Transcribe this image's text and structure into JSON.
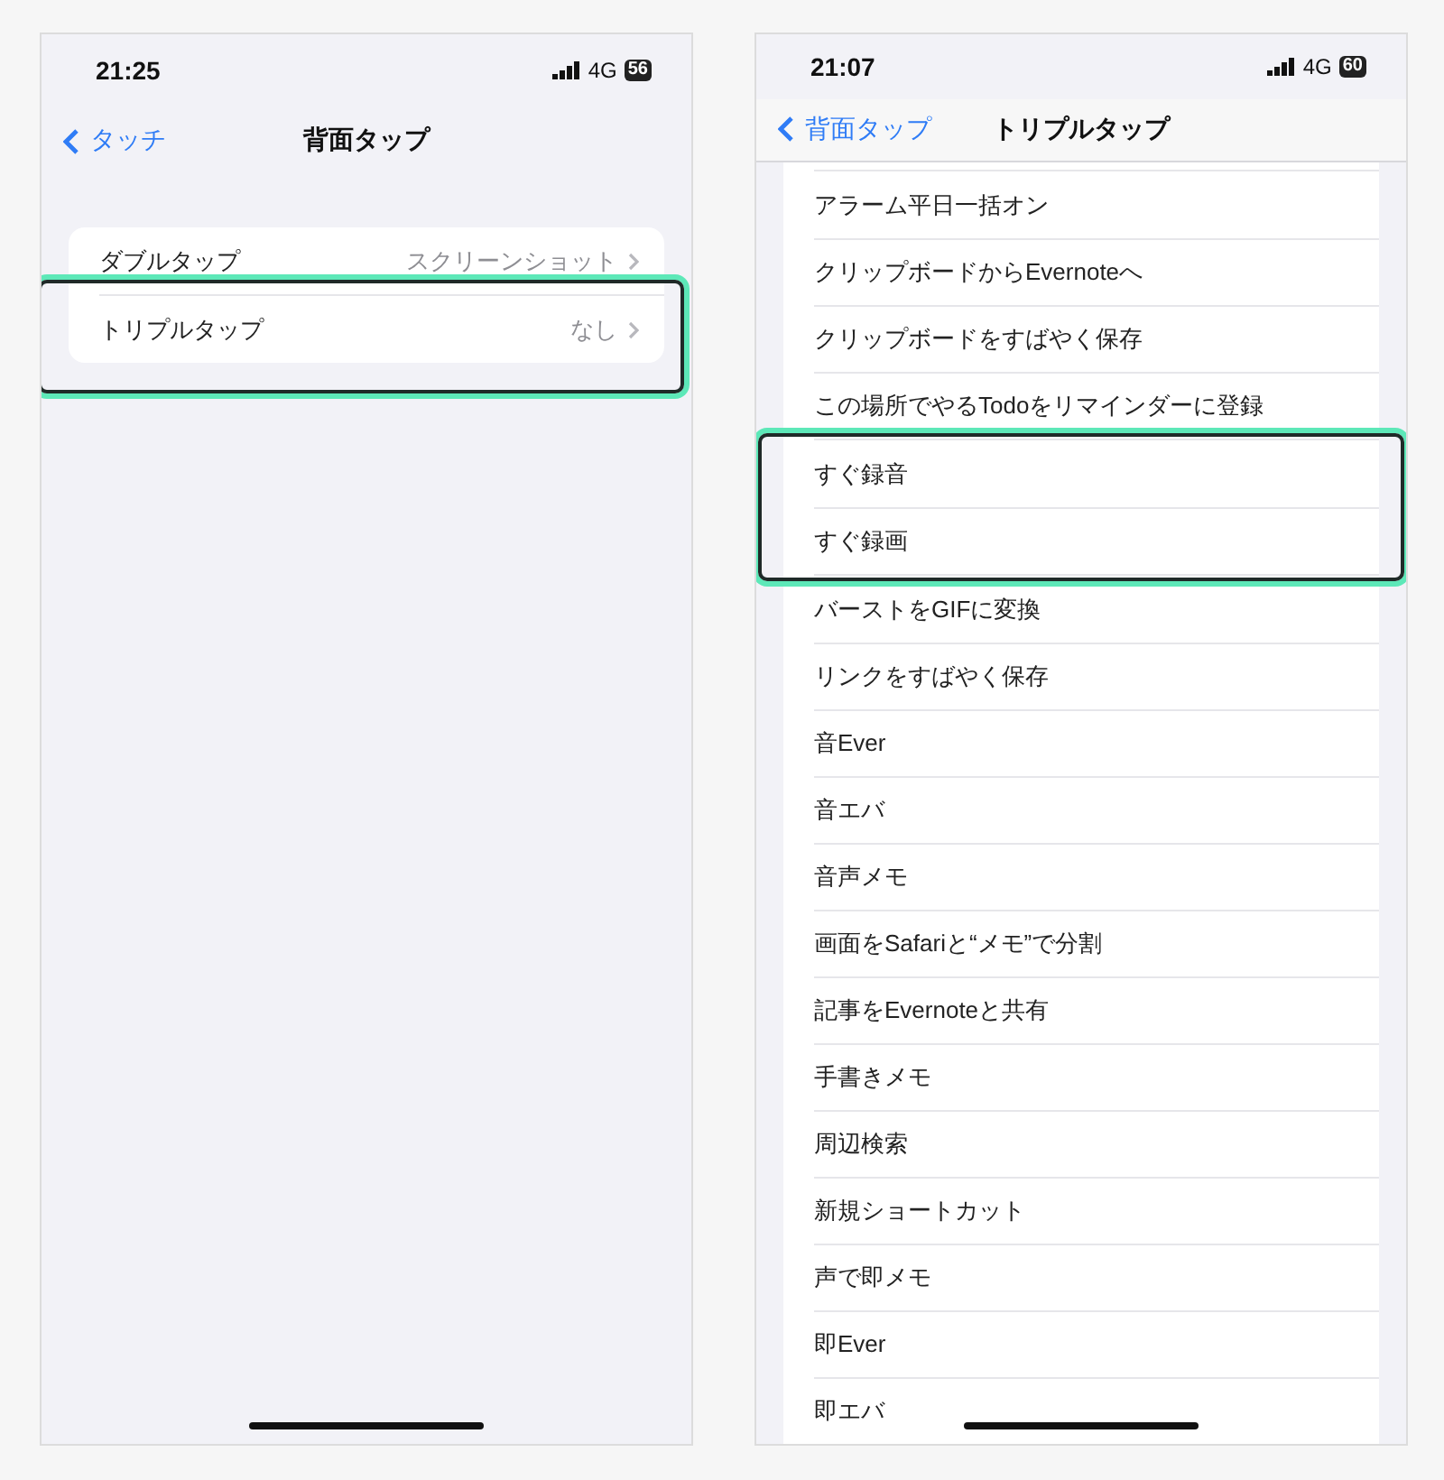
{
  "screens": [
    {
      "kind": "settings",
      "status": {
        "time": "21:25",
        "network": "4G",
        "battery": "56"
      },
      "nav": {
        "back": "タッチ",
        "title": "背面タップ"
      },
      "groups": [
        {
          "highlighted": false,
          "rows": [
            {
              "label": "ダブルタップ",
              "value": "スクリーンショット"
            }
          ]
        },
        {
          "highlighted": true,
          "rows": [
            {
              "label": "トリプルタップ",
              "value": "なし"
            }
          ]
        }
      ]
    },
    {
      "kind": "list",
      "status": {
        "time": "21:07",
        "network": "4G",
        "battery": "60"
      },
      "nav": {
        "back": "背面タップ",
        "title": "トリプルタップ"
      },
      "groups": [
        {
          "highlighted": false,
          "rows": [
            {
              "label": "アラーム平日一括オン"
            },
            {
              "label": "クリップボードからEvernoteへ"
            },
            {
              "label": "クリップボードをすばやく保存"
            },
            {
              "label": "この場所でやるTodoをリマインダーに登録"
            }
          ]
        },
        {
          "highlighted": true,
          "rows": [
            {
              "label": "すぐ録音"
            },
            {
              "label": "すぐ録画"
            }
          ]
        },
        {
          "highlighted": false,
          "rows": [
            {
              "label": "バーストをGIFに変換"
            },
            {
              "label": "リンクをすばやく保存"
            },
            {
              "label": "音Ever"
            },
            {
              "label": "音エバ"
            },
            {
              "label": "音声メモ"
            },
            {
              "label": "画面をSafariと“メモ”で分割"
            },
            {
              "label": "記事をEvernoteと共有"
            },
            {
              "label": "手書きメモ"
            },
            {
              "label": "周辺検索"
            },
            {
              "label": "新規ショートカット"
            },
            {
              "label": "声で即メモ"
            },
            {
              "label": "即Ever"
            },
            {
              "label": "即エバ"
            }
          ]
        }
      ]
    }
  ]
}
